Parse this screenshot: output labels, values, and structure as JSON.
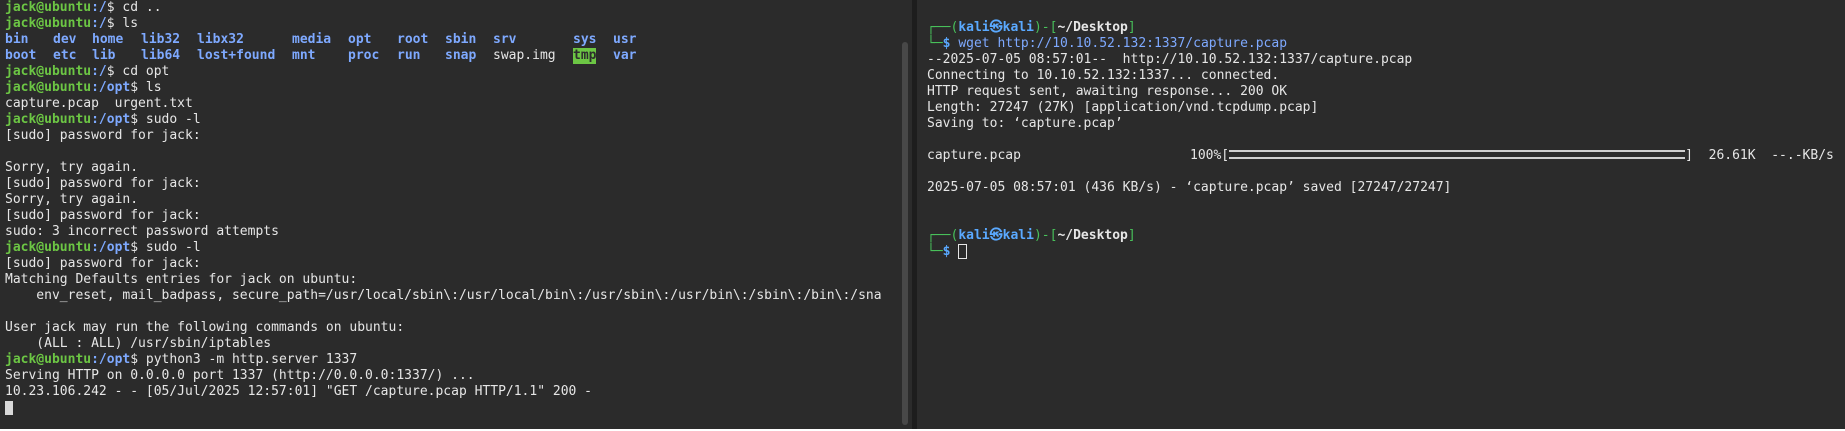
{
  "left_terminal": {
    "user_host": "jack@ubuntu",
    "lines_top": [
      {
        "dir": ":/",
        "cmd": "$ cd .."
      },
      {
        "dir": ":/",
        "cmd": "$ ls"
      }
    ],
    "ls_row1": [
      "bin",
      "dev",
      "home",
      "lib32",
      "libx32",
      "media",
      "opt",
      "root",
      "sbin",
      "srv",
      "sys",
      "usr"
    ],
    "ls_row2": [
      "boot",
      "etc",
      "lib",
      "lib64",
      "lost+found",
      "mnt",
      "proc",
      "run",
      "snap",
      "swap.img",
      "tmp",
      "var"
    ],
    "cd_opt": {
      "dir": ":/",
      "cmd": "$ cd opt"
    },
    "ls_opt": {
      "dir": ":/opt",
      "cmd": "$ ls"
    },
    "opt_files": "capture.pcap  urgent.txt",
    "sudo1": {
      "dir": ":/opt",
      "cmd": "$ sudo -l"
    },
    "output1": [
      "[sudo] password for jack:",
      "",
      "Sorry, try again.",
      "[sudo] password for jack:",
      "Sorry, try again.",
      "[sudo] password for jack:",
      "sudo: 3 incorrect password attempts"
    ],
    "sudo2": {
      "dir": ":/opt",
      "cmd": "$ sudo -l"
    },
    "output2": [
      "[sudo] password for jack:",
      "Matching Defaults entries for jack on ubuntu:",
      "    env_reset, mail_badpass, secure_path=/usr/local/sbin\\:/usr/local/bin\\:/usr/sbin\\:/usr/bin\\:/sbin\\:/bin\\:/sna",
      "",
      "User jack may run the following commands on ubuntu:",
      "    (ALL : ALL) /usr/sbin/iptables"
    ],
    "python": {
      "dir": ":/opt",
      "cmd": "$ python3 -m http.server 1337"
    },
    "output3": [
      "Serving HTTP on 0.0.0.0 port 1337 (http://0.0.0.0:1337/) ...",
      "10.23.106.242 - - [05/Jul/2025 12:57:01] \"GET /capture.pcap HTTP/1.1\" 200 -"
    ]
  },
  "right_terminal": {
    "prompt1_open": "┌──(",
    "prompt_user": "kali",
    "prompt_at": "㉿",
    "prompt_host": "kali",
    "prompt_mid": ")-[",
    "prompt_path": "~/Desktop",
    "prompt_close": "]",
    "prompt_second": "└─",
    "prompt_dollar": "$ ",
    "wget_cmd": "wget http://10.10.52.132:1337/capture.pcap",
    "wget_output": [
      "--2025-07-05 08:57:01--  http://10.10.52.132:1337/capture.pcap",
      "Connecting to 10.10.52.132:1337... connected.",
      "HTTP request sent, awaiting response... 200 OK",
      "Length: 27247 (27K) [application/vnd.tcpdump.pcap]",
      "Saving to: ‘capture.pcap’"
    ],
    "progress_file": "capture.pcap",
    "progress_pct": "100%[",
    "progress_fill": 1.0,
    "progress_end": "]  26.61K  --.-KB/s",
    "saved_line": "2025-07-05 08:57:01 (436 KB/s) - ‘capture.pcap’ saved [27247/27247]"
  }
}
